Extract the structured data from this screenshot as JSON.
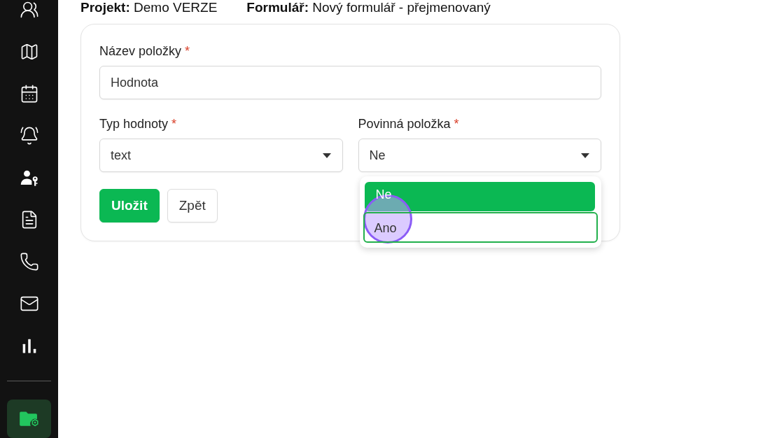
{
  "sidebar": {
    "items": [
      {
        "selected": false
      },
      {
        "selected": false
      },
      {
        "selected": false
      },
      {
        "selected": false
      },
      {
        "selected": false
      },
      {
        "selected": false
      },
      {
        "selected": false
      },
      {
        "selected": false
      },
      {
        "selected": false
      }
    ],
    "footer_items": [
      {
        "selected": true
      }
    ]
  },
  "header": {
    "items": [
      "**Projekt:** Demo VERZE",
      "**Formulář:** Nový formulář - přejmenovaný"
    ]
  },
  "form": {
    "fields": [
      {
        "kind": "text",
        "label": "Název položky",
        "required_mark": "*",
        "value": "Hodnota"
      },
      {
        "kind": "select",
        "label": "Typ hodnoty",
        "required_mark": "*",
        "value": "text"
      },
      {
        "kind": "select",
        "label": "Povinná položka",
        "required_mark": "*",
        "value": "Ne",
        "options": [
          {
            "label": "Ne",
            "selected": true,
            "focused": false
          },
          {
            "label": "Ano",
            "selected": false,
            "focused": true
          }
        ]
      }
    ],
    "buttons": [
      {
        "label": "Uložit",
        "kind": "primary"
      },
      {
        "label": "Zpět",
        "kind": "secondary"
      }
    ]
  },
  "click_indicator": true
}
